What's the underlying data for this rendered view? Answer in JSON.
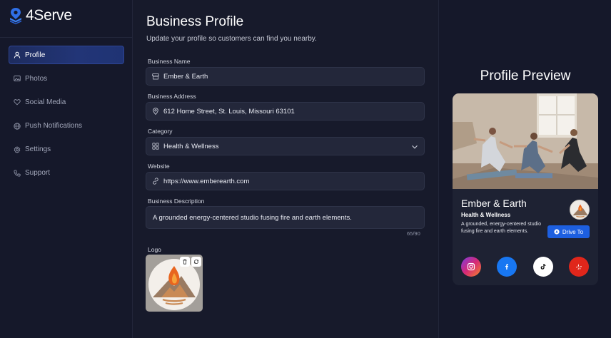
{
  "brand": {
    "name": "4Serve"
  },
  "sidebar": {
    "items": [
      {
        "label": "Profile",
        "icon": "user-icon",
        "active": true
      },
      {
        "label": "Photos",
        "icon": "image-icon"
      },
      {
        "label": "Social Media",
        "icon": "heart-icon"
      },
      {
        "label": "Push Notifications",
        "icon": "globe-icon"
      },
      {
        "label": "Settings",
        "icon": "gear-icon"
      },
      {
        "label": "Support",
        "icon": "phone-icon"
      }
    ]
  },
  "main": {
    "title": "Business Profile",
    "subtitle": "Update your profile so customers can find you nearby.",
    "fields": {
      "name": {
        "label": "Business Name",
        "value": "Ember & Earth"
      },
      "address": {
        "label": "Business Address",
        "value": "612 Home Street, St. Louis, Missouri 63101"
      },
      "category": {
        "label": "Category",
        "value": "Health & Wellness"
      },
      "website": {
        "label": "Website",
        "value": "https://www.emberearth.com"
      },
      "description": {
        "label": "Business Description",
        "value": "A grounded energy-centered studio fusing fire and earth elements.",
        "counter": "65/90"
      },
      "logo": {
        "label": "Logo"
      }
    }
  },
  "preview": {
    "title": "Profile Preview",
    "card": {
      "name": "Ember & Earth",
      "category": "Health & Wellness",
      "description": "A grounded, energy-centered studio fusing fire and earth elements.",
      "drive_label": "Drive To"
    },
    "socials": [
      {
        "name": "instagram-icon",
        "color": "#d62976"
      },
      {
        "name": "facebook-icon",
        "color": "#1877f2"
      },
      {
        "name": "tiktok-icon",
        "color": "#ffffff"
      },
      {
        "name": "yelp-icon",
        "color": "#e0261b"
      }
    ]
  },
  "colors": {
    "accent": "#1d5fe0",
    "background": "#15182a",
    "field": "#23273a"
  }
}
